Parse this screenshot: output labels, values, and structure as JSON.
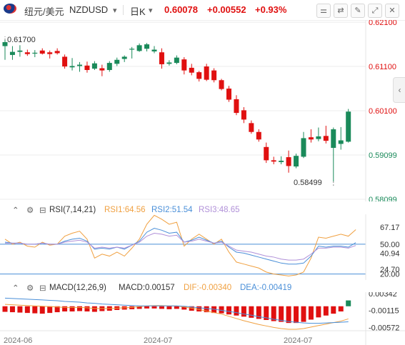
{
  "toolbar": {
    "pair_name": "纽元/美元",
    "symbol": "NZDUSD",
    "symbol_dropdown": "▾",
    "timeframe": "日K",
    "timeframe_dropdown": "▾",
    "price": "0.60078",
    "change": "+0.00552",
    "change_pct": "+0.93%",
    "icons": [
      "settings-sliders-icon",
      "toggle-icon",
      "drawing-tools-icon",
      "expand-icon",
      "close-icon"
    ]
  },
  "price_axis": {
    "labels": [
      {
        "text": "0.62100",
        "value": 0.621
      },
      {
        "text": "0.61100",
        "value": 0.611
      },
      {
        "text": "0.60100",
        "value": 0.601
      },
      {
        "text": "0.59099",
        "value": 0.59099
      },
      {
        "text": "0.58099",
        "value": 0.58099
      }
    ],
    "high_marker": "0.61700",
    "low_marker": "0.58499"
  },
  "rsi": {
    "label": "RSI(7,14,21)",
    "rsi1": "RSI1:64.56",
    "rsi2": "RSI2:51.54",
    "rsi3": "RSI3:48.65",
    "axis": [
      "67.17",
      "50.00",
      "40.94",
      "24.70",
      "20.00"
    ]
  },
  "macd": {
    "label": "MACD(12,26,9)",
    "macd": "MACD:0.00157",
    "dif": "DIF:-0.00340",
    "dea": "DEA:-0.00419",
    "axis": [
      "0.00342",
      "-0.00115",
      "-0.00572"
    ]
  },
  "time_axis": [
    "2024-06",
    "2024-07",
    "2024-07"
  ],
  "colors": {
    "up": "#e01010",
    "down": "#1a8a5a",
    "rsi1": "#f0a040",
    "rsi2": "#4a8fd8",
    "rsi3": "#b090d8",
    "grid": "#ececec"
  },
  "chart_data": [
    {
      "type": "candlestick",
      "title": "纽元/美元 NZDUSD 日K",
      "ylim": [
        0.5805,
        0.6215
      ],
      "candles": [
        {
          "o": 0.6156,
          "c": 0.6165,
          "h": 0.617,
          "l": 0.6125
        },
        {
          "o": 0.6136,
          "c": 0.6143,
          "h": 0.6156,
          "l": 0.6125
        },
        {
          "o": 0.6143,
          "c": 0.6146,
          "h": 0.6158,
          "l": 0.6132
        },
        {
          "o": 0.6142,
          "c": 0.6138,
          "h": 0.6148,
          "l": 0.6134
        },
        {
          "o": 0.614,
          "c": 0.6141,
          "h": 0.6147,
          "l": 0.6131
        },
        {
          "o": 0.6146,
          "c": 0.6139,
          "h": 0.6151,
          "l": 0.6137
        },
        {
          "o": 0.6142,
          "c": 0.6138,
          "h": 0.6146,
          "l": 0.6128
        },
        {
          "o": 0.6145,
          "c": 0.614,
          "h": 0.6151,
          "l": 0.6137
        },
        {
          "o": 0.6132,
          "c": 0.611,
          "h": 0.6137,
          "l": 0.6105
        },
        {
          "o": 0.6108,
          "c": 0.6111,
          "h": 0.6129,
          "l": 0.6101
        },
        {
          "o": 0.6111,
          "c": 0.6114,
          "h": 0.612,
          "l": 0.6098
        },
        {
          "o": 0.6112,
          "c": 0.6102,
          "h": 0.6121,
          "l": 0.6096
        },
        {
          "o": 0.6105,
          "c": 0.6117,
          "h": 0.6122,
          "l": 0.6102
        },
        {
          "o": 0.6106,
          "c": 0.6101,
          "h": 0.6114,
          "l": 0.6088
        },
        {
          "o": 0.6102,
          "c": 0.6118,
          "h": 0.6122,
          "l": 0.6098
        },
        {
          "o": 0.6116,
          "c": 0.6125,
          "h": 0.613,
          "l": 0.6111
        },
        {
          "o": 0.6127,
          "c": 0.6132,
          "h": 0.6135,
          "l": 0.612
        },
        {
          "o": 0.6149,
          "c": 0.615,
          "h": 0.6154,
          "l": 0.6128
        },
        {
          "o": 0.6145,
          "c": 0.6158,
          "h": 0.6162,
          "l": 0.6143
        },
        {
          "o": 0.615,
          "c": 0.616,
          "h": 0.6163,
          "l": 0.6144
        },
        {
          "o": 0.6144,
          "c": 0.6148,
          "h": 0.6156,
          "l": 0.614
        },
        {
          "o": 0.6142,
          "c": 0.6115,
          "h": 0.6151,
          "l": 0.6105
        },
        {
          "o": 0.6116,
          "c": 0.6119,
          "h": 0.6124,
          "l": 0.6112
        },
        {
          "o": 0.6118,
          "c": 0.613,
          "h": 0.6135,
          "l": 0.6115
        },
        {
          "o": 0.6126,
          "c": 0.6101,
          "h": 0.6131,
          "l": 0.6092
        },
        {
          "o": 0.6107,
          "c": 0.6096,
          "h": 0.6116,
          "l": 0.609
        },
        {
          "o": 0.6097,
          "c": 0.6082,
          "h": 0.61,
          "l": 0.6076
        },
        {
          "o": 0.611,
          "c": 0.608,
          "h": 0.6116,
          "l": 0.6077
        },
        {
          "o": 0.6101,
          "c": 0.6079,
          "h": 0.6106,
          "l": 0.6074
        },
        {
          "o": 0.6079,
          "c": 0.6059,
          "h": 0.6082,
          "l": 0.6056
        },
        {
          "o": 0.606,
          "c": 0.6035,
          "h": 0.6066,
          "l": 0.603
        },
        {
          "o": 0.6036,
          "c": 0.6005,
          "h": 0.6045,
          "l": 0.6
        },
        {
          "o": 0.6011,
          "c": 0.599,
          "h": 0.6018,
          "l": 0.5982
        },
        {
          "o": 0.5982,
          "c": 0.5962,
          "h": 0.5988,
          "l": 0.5958
        },
        {
          "o": 0.5962,
          "c": 0.5945,
          "h": 0.5968,
          "l": 0.594
        },
        {
          "o": 0.5928,
          "c": 0.5898,
          "h": 0.5938,
          "l": 0.5892
        },
        {
          "o": 0.5898,
          "c": 0.5895,
          "h": 0.5906,
          "l": 0.5889
        },
        {
          "o": 0.5894,
          "c": 0.5897,
          "h": 0.5907,
          "l": 0.5889
        },
        {
          "o": 0.5905,
          "c": 0.5885,
          "h": 0.592,
          "l": 0.587
        },
        {
          "o": 0.5884,
          "c": 0.5908,
          "h": 0.5913,
          "l": 0.588
        },
        {
          "o": 0.5906,
          "c": 0.5948,
          "h": 0.5962,
          "l": 0.5903
        },
        {
          "o": 0.595,
          "c": 0.5945,
          "h": 0.5968,
          "l": 0.5938
        },
        {
          "o": 0.5946,
          "c": 0.5952,
          "h": 0.5972,
          "l": 0.5941
        },
        {
          "o": 0.5953,
          "c": 0.5942,
          "h": 0.5976,
          "l": 0.5936
        },
        {
          "o": 0.5926,
          "c": 0.5968,
          "h": 0.5972,
          "l": 0.585
        },
        {
          "o": 0.5935,
          "c": 0.5943,
          "h": 0.5973,
          "l": 0.5922
        },
        {
          "o": 0.594,
          "c": 0.6008,
          "h": 0.6014,
          "l": 0.5938
        }
      ]
    },
    {
      "type": "line",
      "title": "RSI(7,14,21)",
      "ylim": [
        14,
        80
      ],
      "series": [
        {
          "name": "RSI1",
          "values": [
            55,
            50,
            52,
            48,
            47,
            52,
            49,
            50,
            58,
            61,
            63,
            55,
            36,
            40,
            38,
            42,
            38,
            46,
            55,
            70,
            79,
            75,
            70,
            72,
            48,
            55,
            60,
            55,
            50,
            55,
            42,
            32,
            30,
            28,
            26,
            22,
            20,
            19,
            18,
            19,
            22,
            36,
            57,
            56,
            58,
            60,
            58,
            64.56
          ]
        },
        {
          "name": "RSI2",
          "values": [
            52,
            51,
            51,
            50,
            50,
            51,
            50,
            50,
            53,
            55,
            56,
            53,
            45,
            46,
            45,
            47,
            45,
            49,
            53,
            62,
            66,
            64,
            61,
            62,
            52,
            54,
            57,
            54,
            51,
            53,
            47,
            42,
            41,
            39,
            37,
            35,
            33,
            31,
            30,
            30,
            31,
            38,
            48,
            47,
            48,
            48,
            47,
            51.54
          ]
        },
        {
          "name": "RSI3",
          "values": [
            51,
            51,
            51,
            50,
            50,
            51,
            50,
            50,
            52,
            53,
            54,
            52,
            46,
            47,
            46,
            47,
            46,
            49,
            52,
            58,
            61,
            60,
            58,
            59,
            52,
            53,
            55,
            53,
            51,
            52,
            48,
            44,
            43,
            42,
            40,
            38,
            37,
            35,
            34,
            34,
            35,
            40,
            46,
            46,
            47,
            47,
            46,
            48.65
          ]
        }
      ]
    },
    {
      "type": "bar",
      "title": "MACD(12,26,9)",
      "ylim": [
        -0.0062,
        0.0038
      ],
      "macd_values": [
        -0.0015,
        -0.0016,
        -0.0017,
        -0.0018,
        -0.0019,
        -0.002,
        -0.0018,
        -0.0016,
        -0.0014,
        -0.0014,
        -0.0013,
        -0.0014,
        -0.0015,
        -0.0013,
        -0.0012,
        -0.001,
        -0.0009,
        -0.0008,
        -0.0007,
        -0.0006,
        -0.0006,
        -0.0007,
        -0.0008,
        -0.0007,
        -0.0009,
        -0.0012,
        -0.0014,
        -0.0016,
        -0.0018,
        -0.0019,
        -0.0022,
        -0.0025,
        -0.0028,
        -0.0031,
        -0.0034,
        -0.0037,
        -0.004,
        -0.0042,
        -0.0045,
        -0.0045,
        -0.0042,
        -0.0036,
        -0.003,
        -0.0025,
        -0.002,
        -0.0014,
        0.00157
      ],
      "series": [
        {
          "name": "DIF",
          "values": [
            0.0005,
            0.0004,
            0.0003,
            0.0002,
            0.0001,
            0.0,
            -0.0001,
            -0.0002,
            -0.0003,
            -0.0003,
            -0.0003,
            -0.0004,
            -0.0006,
            -0.0006,
            -0.0006,
            -0.0005,
            -0.0004,
            -0.0003,
            -0.0001,
            0.0001,
            0.0002,
            0.0002,
            0.0001,
            0.0001,
            -0.0002,
            -0.0005,
            -0.0009,
            -0.0013,
            -0.0017,
            -0.0021,
            -0.0027,
            -0.0033,
            -0.0039,
            -0.0044,
            -0.0049,
            -0.0053,
            -0.0057,
            -0.006,
            -0.0062,
            -0.0062,
            -0.006,
            -0.0056,
            -0.0052,
            -0.0048,
            -0.0044,
            -0.004,
            -0.0034
          ]
        },
        {
          "name": "DEA",
          "values": [
            0.0022,
            0.0021,
            0.002,
            0.0019,
            0.0018,
            0.0017,
            0.0016,
            0.0015,
            0.0013,
            0.0012,
            0.0011,
            0.0009,
            0.0008,
            0.0006,
            0.0005,
            0.0004,
            0.0003,
            0.0002,
            0.0001,
            0.0001,
            0.0001,
            0.0001,
            0.0001,
            0.0001,
            0.0,
            -0.0002,
            -0.0004,
            -0.0006,
            -0.0008,
            -0.0011,
            -0.0014,
            -0.0017,
            -0.0021,
            -0.0024,
            -0.0028,
            -0.0031,
            -0.0035,
            -0.0038,
            -0.0041,
            -0.0043,
            -0.0045,
            -0.0046,
            -0.0046,
            -0.0045,
            -0.0044,
            -0.0043,
            -0.00419
          ]
        }
      ]
    }
  ]
}
